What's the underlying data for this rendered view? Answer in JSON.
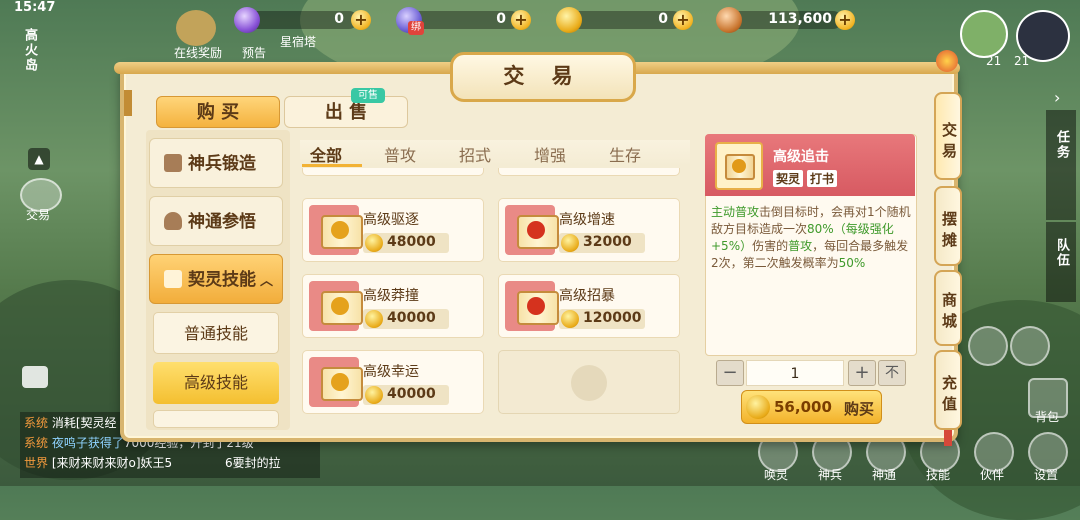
{
  "status": {
    "time": "15:47"
  },
  "resources": [
    {
      "name": "purple-jade-icon",
      "value": "0"
    },
    {
      "name": "bound-jade-icon",
      "value": "0",
      "badge": "绑"
    },
    {
      "name": "gold-ingot-icon",
      "value": "0"
    },
    {
      "name": "copper-coin-icon",
      "value": "113,600"
    }
  ],
  "hud": {
    "island": "高火岛",
    "left_buttons": [
      "在线奖励",
      "预告",
      "星宿塔"
    ],
    "trade_label": "交易",
    "right_vertical": [
      "任务",
      "队伍"
    ],
    "avatar_levels": [
      "21",
      "21"
    ],
    "bottom_buttons": [
      "唤灵",
      "神兵",
      "神通",
      "技能",
      "伙伴",
      "设置"
    ],
    "backpack": "背包",
    "chat": [
      {
        "channel": "系统",
        "text": "消耗[契灵经"
      },
      {
        "channel": "系统",
        "text": "夜鸣子获得了",
        "extra": "7000经验，升到了21级"
      },
      {
        "channel": "世界",
        "text": "[来财来财来财o]妖王5",
        "extra": "6要封的拉"
      }
    ]
  },
  "panel": {
    "title": "交 易",
    "tabs": {
      "buy": "购 买",
      "sell": "出 售",
      "sell_badge": "可售"
    },
    "categories": [
      {
        "label": "神兵锻造"
      },
      {
        "label": "神通参悟"
      },
      {
        "label": "契灵技能",
        "expanded": true
      }
    ],
    "subcategories": [
      "普通技能",
      "高级技能"
    ],
    "filters": [
      "全部",
      "普攻",
      "招式",
      "增强",
      "生存"
    ],
    "active_filter": "全部",
    "items": [
      {
        "name": "高级驱逐",
        "price": "48000"
      },
      {
        "name": "高级增速",
        "price": "32000"
      },
      {
        "name": "高级莽撞",
        "price": "40000"
      },
      {
        "name": "高级招暴",
        "price": "120000"
      },
      {
        "name": "高级幸运",
        "price": "40000"
      }
    ],
    "detail": {
      "name": "高级追击",
      "tags": [
        "契灵",
        "打书"
      ],
      "desc_parts": [
        {
          "t": "主动普攻",
          "c": "green"
        },
        {
          "t": "击倒目标时，会再对1个随机敌方目标造成一次",
          "c": "brown"
        },
        {
          "t": "80%",
          "c": "green"
        },
        {
          "t": "（每级强化+5%）",
          "c": "green"
        },
        {
          "t": "伤害的",
          "c": "brown"
        },
        {
          "t": "普攻",
          "c": "green"
        },
        {
          "t": "，每回合最多触发2次，第二次触发概率为",
          "c": "brown"
        },
        {
          "t": "50%",
          "c": "green"
        }
      ]
    },
    "quantity": "1",
    "qty_minus": "−",
    "qty_plus": "+",
    "qty_max": "不",
    "total_price": "56,000",
    "buy_button": "购买",
    "side_tabs": [
      "交易",
      "摆摊",
      "商城",
      "充值"
    ]
  },
  "colors": {
    "accent": "#f5c542",
    "panel_bg": "#f4ecd4",
    "green_text": "#3f9a2b",
    "red_header": "#d75a62"
  }
}
